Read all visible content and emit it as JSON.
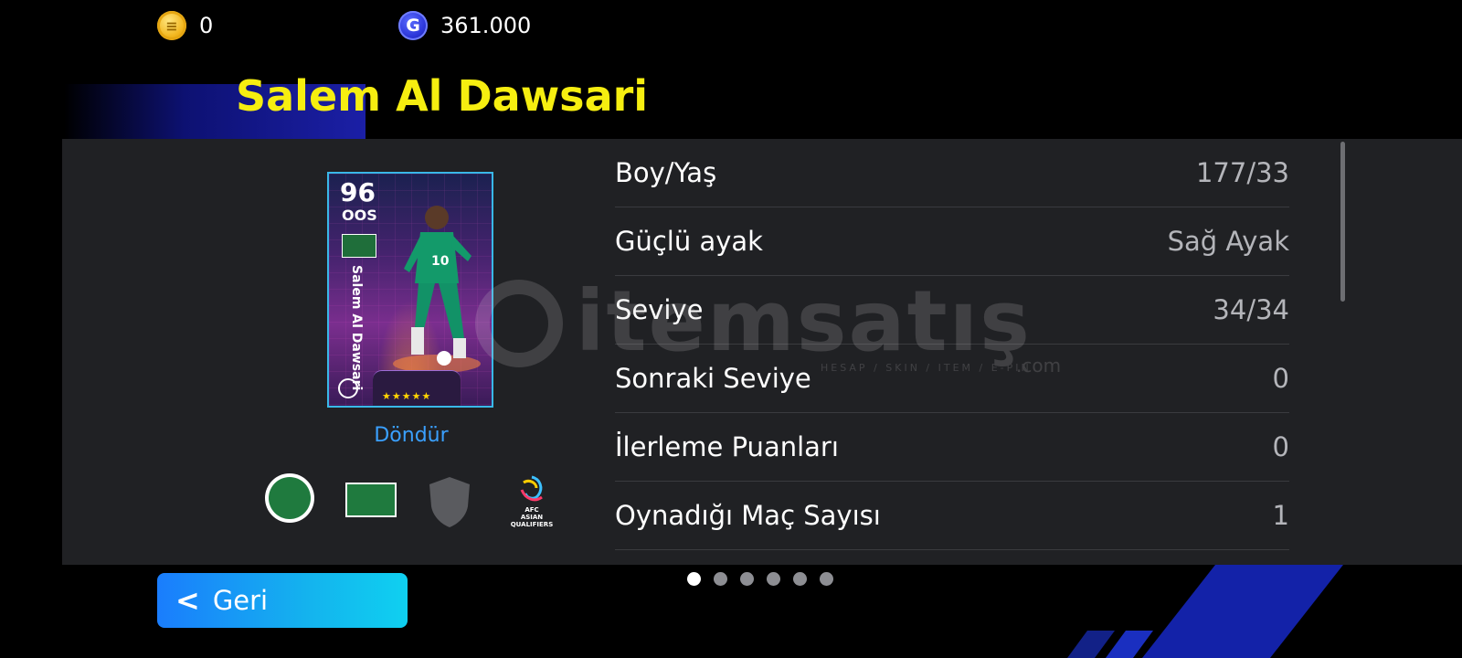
{
  "currency": {
    "gold_amount": "0",
    "gp_amount": "361.000",
    "gp_symbol": "G"
  },
  "player": {
    "name": "Salem Al Dawsari"
  },
  "card": {
    "rating": "96",
    "position": "OOS",
    "name": "Salem Al Dawsari",
    "stars": "★★★★★"
  },
  "rotate_label": "Döndür",
  "badges": {
    "afc_line1": "AFC",
    "afc_line2": "ASIAN",
    "afc_line3": "QUALIFIERS"
  },
  "stats": [
    {
      "label": "Boy/Yaş",
      "value": "177/33"
    },
    {
      "label": "Güçlü ayak",
      "value": "Sağ Ayak"
    },
    {
      "label": "Seviye",
      "value": "34/34"
    },
    {
      "label": "Sonraki Seviye",
      "value": "0"
    },
    {
      "label": "İlerleme Puanları",
      "value": "0"
    },
    {
      "label": "Oynadığı Maç Sayısı",
      "value": "1"
    }
  ],
  "watermark": {
    "brand": "itemsatış",
    "tagline": "HESAP / SKIN / ITEM / E-PIN",
    "suffix": ".com"
  },
  "pagination": {
    "total": 6,
    "active": 1
  },
  "back_button": {
    "label": "Geri"
  },
  "colors": {
    "title_yellow": "#f6ee10",
    "link_blue": "#3aa0ff",
    "panel_bg": "#202124",
    "back_gradient_start": "#1a7dfd",
    "back_gradient_end": "#0fd0f0"
  }
}
